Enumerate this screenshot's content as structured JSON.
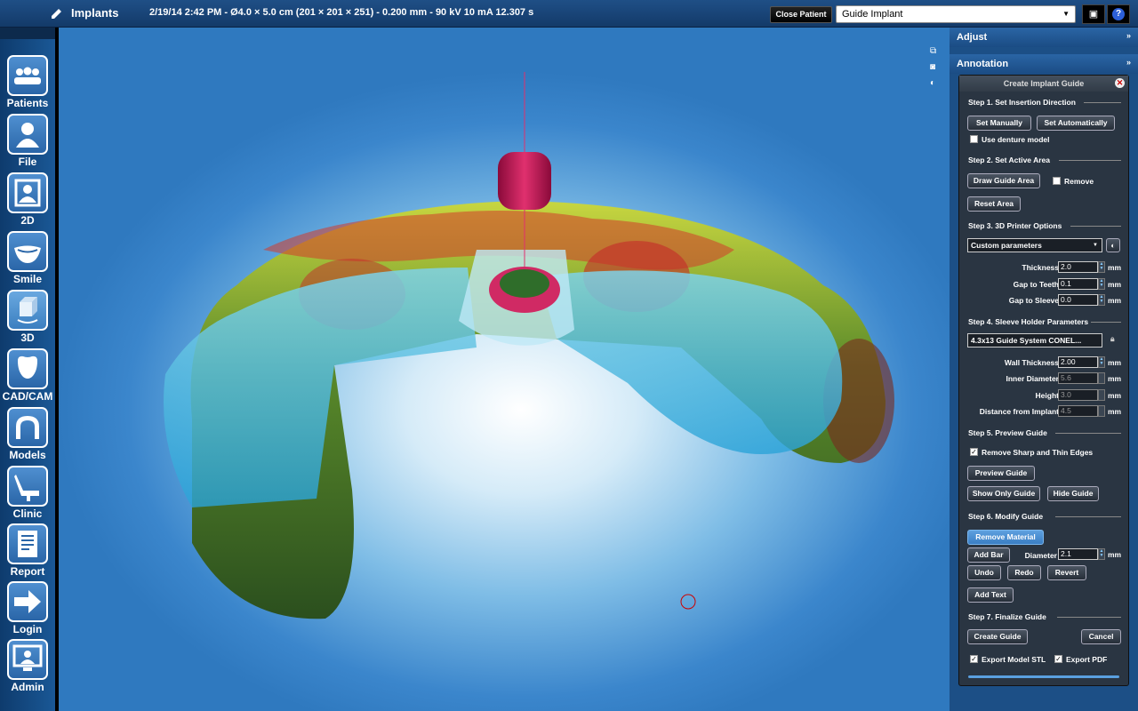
{
  "header": {
    "app_title": "Implants",
    "scan_info": "2/19/14 2:42 PM - Ø4.0 × 5.0 cm (201 × 201 × 251) - 0.200 mm - 90 kV 10 mA 12.307 s",
    "close_patient": "Close Patient",
    "mode_selected": "Guide Implant"
  },
  "sidebar": {
    "items": [
      {
        "label": "Patients",
        "icon": "patients-icon"
      },
      {
        "label": "File",
        "icon": "person-icon"
      },
      {
        "label": "2D",
        "icon": "2d-icon"
      },
      {
        "label": "Smile",
        "icon": "smile-icon"
      },
      {
        "label": "3D",
        "icon": "cube-icon"
      },
      {
        "label": "CAD/CAM",
        "icon": "tooth-icon"
      },
      {
        "label": "Models",
        "icon": "arch-icon"
      },
      {
        "label": "Clinic",
        "icon": "chair-icon"
      },
      {
        "label": "Report",
        "icon": "report-icon"
      },
      {
        "label": "Login",
        "icon": "login-arrow-icon"
      },
      {
        "label": "Admin",
        "icon": "admin-icon"
      }
    ]
  },
  "right_panel": {
    "adjust": "Adjust",
    "annotation": "Annotation"
  },
  "dialog": {
    "title": "Create Implant Guide",
    "step1": {
      "title": "Step 1. Set Insertion Direction",
      "set_manually": "Set Manually",
      "set_automatically": "Set Automatically",
      "use_denture": "Use denture model"
    },
    "step2": {
      "title": "Step 2. Set Active Area",
      "draw_area": "Draw Guide Area",
      "remove": "Remove",
      "reset_area": "Reset Area"
    },
    "step3": {
      "title": "Step 3. 3D Printer Options",
      "preset": "Custom parameters",
      "thickness_label": "Thickness",
      "thickness": "2.0",
      "gap_teeth_label": "Gap to Teeth",
      "gap_teeth": "0.1",
      "gap_sleeve_label": "Gap to Sleeve",
      "gap_sleeve": "0.0",
      "unit": "mm"
    },
    "step4": {
      "title": "Step 4. Sleeve Holder Parameters",
      "system": "4.3x13 Guide System CONEL...",
      "wall_label": "Wall Thickness",
      "wall": "2.00",
      "inner_label": "Inner Diameter",
      "inner": "5.6",
      "height_label": "Height",
      "height": "3.0",
      "distance_label": "Distance from Implant",
      "distance": "4.5",
      "unit": "mm"
    },
    "step5": {
      "title": "Step 5. Preview Guide",
      "remove_sharp": "Remove Sharp and Thin Edges",
      "preview": "Preview Guide",
      "show_only": "Show Only Guide",
      "hide": "Hide Guide"
    },
    "step6": {
      "title": "Step 6. Modify Guide",
      "remove_material": "Remove Material",
      "add_bar": "Add Bar",
      "diameter_label": "Diameter",
      "diameter": "2.1",
      "unit": "mm",
      "undo": "Undo",
      "redo": "Redo",
      "revert": "Revert",
      "add_text": "Add Text"
    },
    "step7": {
      "title": "Step 7. Finalize Guide",
      "create": "Create Guide",
      "cancel": "Cancel",
      "export_stl": "Export Model STL",
      "export_pdf": "Export PDF"
    }
  }
}
